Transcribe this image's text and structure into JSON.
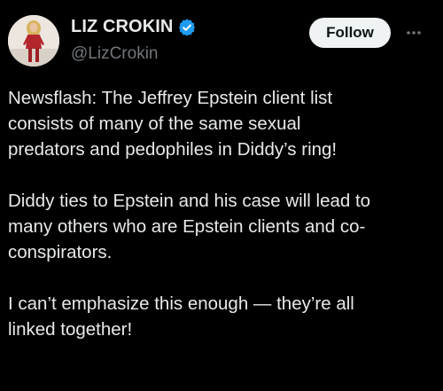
{
  "author": {
    "display_name": "LIZ CROKIN",
    "handle": "@LizCrokin",
    "verified": true,
    "verified_color": "#1d9bf0",
    "avatar_icon": "profile-avatar"
  },
  "actions": {
    "follow_label": "Follow",
    "more_icon": "more-horizontal-icon"
  },
  "tweet": {
    "paragraphs": [
      "Newsflash: The Jeffrey Epstein client list\nconsists of many of the same sexual\npredators and pedophiles in Diddy’s ring!",
      "Diddy ties to Epstein and his case will lead to\nmany others who are Epstein clients and co-\nconspirators.",
      "I can’t emphasize this enough — they’re all\nlinked together!"
    ]
  },
  "colors": {
    "background": "#000000",
    "text_primary": "#e7e9ea",
    "text_secondary": "#71767b",
    "follow_button_bg": "#eff3f4",
    "follow_button_text": "#0f1419"
  }
}
